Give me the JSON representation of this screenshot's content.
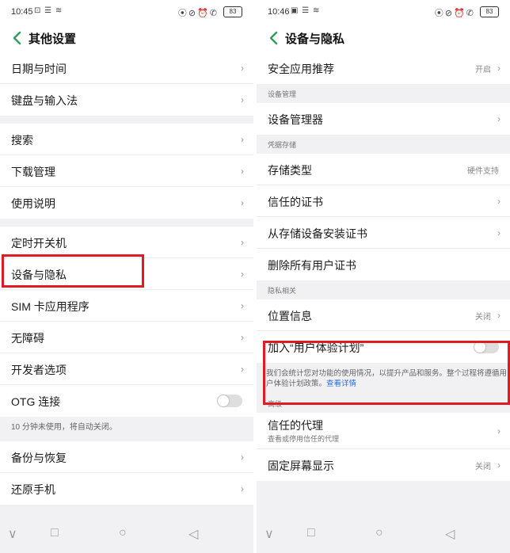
{
  "status_left": {
    "time": "10:45",
    "icons": "⊡ ☰ ≋",
    "right_icons": "⦿⊘⏰✆",
    "battery": "83"
  },
  "status_right": {
    "time": "10:46",
    "icons": "▣ ☰ ≋",
    "right_icons": "⦿⊘⏰✆",
    "battery": "83"
  },
  "left": {
    "title": "其他设置",
    "group1": [
      "日期与时间",
      "键盘与输入法"
    ],
    "group2": [
      "搜索",
      "下载管理",
      "使用说明"
    ],
    "group3": [
      "定时开关机",
      "设备与隐私",
      "SIM 卡应用程序",
      "无障碍",
      "开发者选项"
    ],
    "otg_label": "OTG 连接",
    "otg_note": "10 分钟未使用，将自动关闭。",
    "group4": [
      "备份与恢复",
      "还原手机"
    ]
  },
  "right": {
    "title": "设备与隐私",
    "safe_app": {
      "label": "安全应用推荐",
      "value": "开启"
    },
    "device_mgmt_header": "设备管理",
    "device_manager": "设备管理器",
    "credential_header": "凭据存储",
    "storage_type": {
      "label": "存储类型",
      "value": "硬件支持"
    },
    "trusted_cert": "信任的证书",
    "install_cert": "从存储设备安装证书",
    "delete_cert": "删除所有用户证书",
    "privacy_header": "隐私相关",
    "location": {
      "label": "位置信息",
      "value": "关闭"
    },
    "ux_plan": "加入“用户体验计划”",
    "ux_note": "我们会统计您对功能的使用情况，以提升产品和服务。整个过程将遵循用户体验计划政策。",
    "ux_link": "查看详情",
    "advanced_header": "高级",
    "trust_agent": {
      "label": "信任的代理",
      "sub": "查看或停用信任的代理"
    },
    "screen_pin": {
      "label": "固定屏幕显示",
      "value": "关闭"
    }
  },
  "chevron": "›",
  "nav": {
    "back": "◁",
    "home": "○",
    "recents": "□",
    "down": "∨"
  },
  "colors": {
    "highlight": "#e01b24",
    "accent_green": "#2e9e5b",
    "link": "#2a6edb"
  }
}
